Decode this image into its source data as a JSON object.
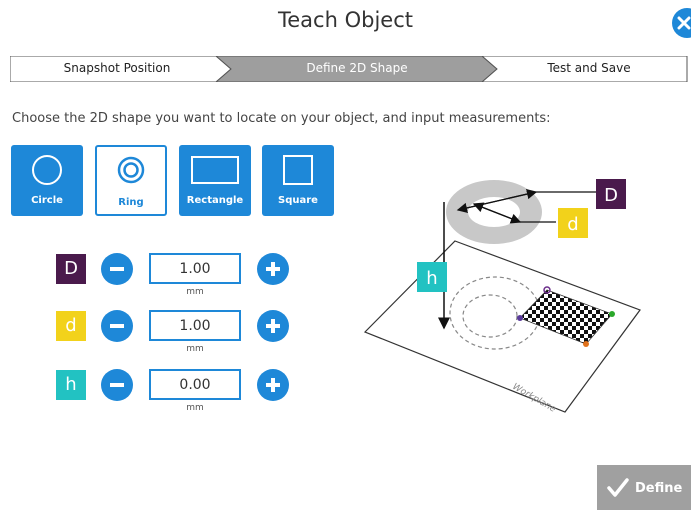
{
  "header": {
    "title": "Teach Object"
  },
  "steps": [
    {
      "label": "Snapshot Position",
      "state": "done"
    },
    {
      "label": "Define 2D Shape",
      "state": "active"
    },
    {
      "label": "Test and Save",
      "state": "pending"
    }
  ],
  "instruction": "Choose the 2D shape you want to locate on your object, and input measurements:",
  "shapes": [
    {
      "label": "Circle",
      "icon": "circle-icon",
      "selected": false
    },
    {
      "label": "Ring",
      "icon": "ring-icon",
      "selected": true
    },
    {
      "label": "Rectangle",
      "icon": "rectangle-icon",
      "selected": false
    },
    {
      "label": "Square",
      "icon": "square-icon",
      "selected": false
    }
  ],
  "params": [
    {
      "letter": "D",
      "value": "1.00",
      "unit": "mm",
      "color": "#4a1a4c"
    },
    {
      "letter": "d",
      "value": "1.00",
      "unit": "mm",
      "color": "#f2d21b"
    },
    {
      "letter": "h",
      "value": "0.00",
      "unit": "mm",
      "color": "#22c2c2"
    }
  ],
  "illustration": {
    "labels": {
      "D": "D",
      "d": "d",
      "h": "h",
      "plane": "Workplane"
    }
  },
  "footer": {
    "define_label": "Define"
  },
  "colors": {
    "accent": "#1e88d8",
    "stepper_active": "#9e9e9e",
    "define_button": "#a0a0a0",
    "badge_D": "#4a1a4c",
    "badge_d": "#f2d21b",
    "badge_h": "#22c2c2"
  }
}
